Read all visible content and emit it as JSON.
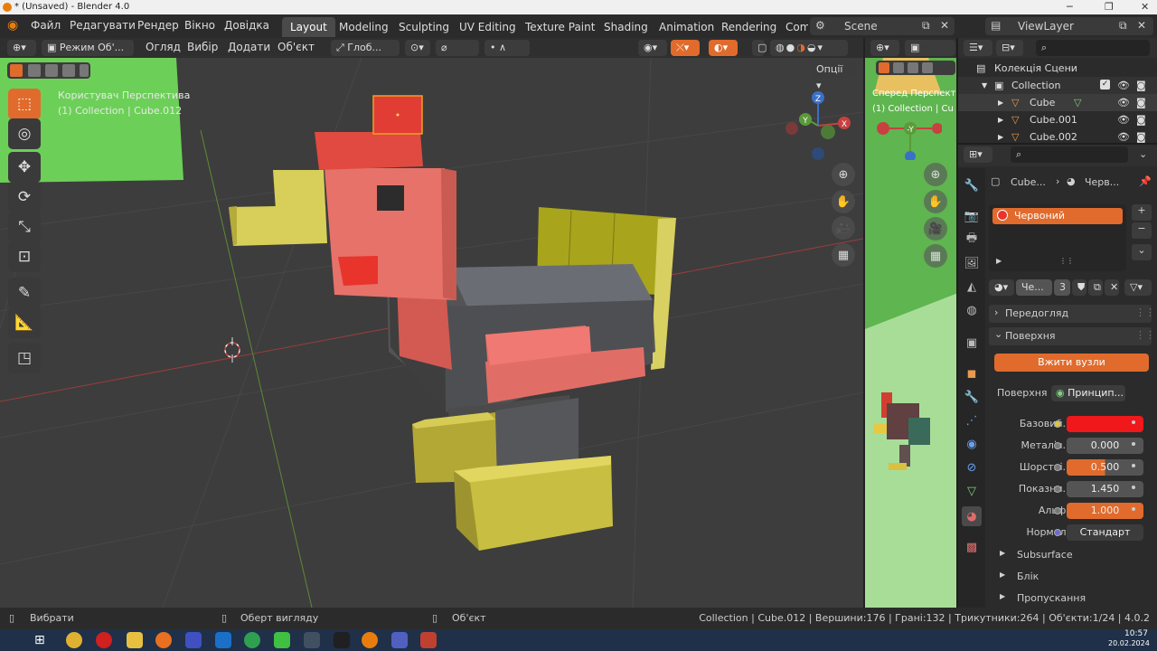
{
  "window": {
    "title": "* (Unsaved) - Blender 4.0"
  },
  "menu": [
    "Файл",
    "Редагувати",
    "Рендер",
    "Вікно",
    "Довідка"
  ],
  "workspaces": [
    "Layout",
    "Modeling",
    "Sculpting",
    "UV Editing",
    "Texture Paint",
    "Shading",
    "Animation",
    "Rendering",
    "Com"
  ],
  "scene": {
    "label": "Scene",
    "view_layer": "ViewLayer"
  },
  "viewport_header": {
    "mode": "Режим Об'...",
    "view": "Огляд",
    "select": "Вибір",
    "add": "Додати",
    "object": "Об'єкт",
    "orientation": "Глоб...",
    "options": "Опції"
  },
  "viewport": {
    "view_name": "Користувач Перспектива",
    "collection_info": "(1) Collection | Cube.012"
  },
  "right_viewport": {
    "view_name": "Сперед Перспект",
    "collection_info": "(1) Collection | Cu"
  },
  "outliner": {
    "scene_collection": "Колекція Сцени",
    "items": [
      {
        "label": "Collection"
      },
      {
        "label": "Cube"
      },
      {
        "label": "Cube.001"
      },
      {
        "label": "Cube.002"
      }
    ]
  },
  "properties": {
    "breadcrumb_object": "Cube...",
    "breadcrumb_material": "Черв...",
    "material_slot": "Червоний",
    "material_name": "Че...",
    "users": "3",
    "panel_preview": "Передогляд",
    "panel_surface": "Поверхня",
    "use_nodes": "Вжити вузли",
    "surface_label": "Поверхня",
    "surface_value": "Принцип...",
    "base_color_label": "Базовий...",
    "base_color": "#f0181a",
    "metallic_label": "Металіч...",
    "metallic": "0.000",
    "roughness_label": "Шорсткі...",
    "roughness": "0.500",
    "ior_label": "Показни...",
    "ior": "1.450",
    "alpha_label": "Альфа",
    "alpha": "1.000",
    "normal_label": "Нормаль",
    "normal_value": "Стандарт",
    "sub_panels": [
      "Subsurface",
      "Блік",
      "Пропускання"
    ]
  },
  "statusbar": {
    "select": "Вибрати",
    "rotate_view": "Оберт вигляду",
    "object": "Об'єкт",
    "stats": "Collection | Cube.012 | Вершини:176 | Грані:132 | Трикутники:264 | Об'єкти:1/24 | 4.0.2"
  },
  "taskbar": {
    "time": "10:57",
    "date": "20.02.2024"
  },
  "colors": {
    "accent": "#e06b2c",
    "bg": "#3d3d3d",
    "panel": "#2b2b2b"
  }
}
